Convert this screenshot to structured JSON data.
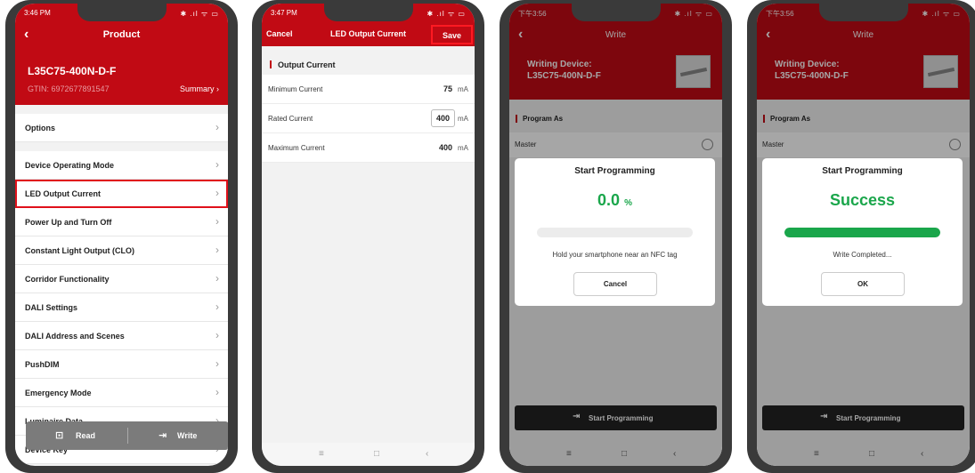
{
  "phone1": {
    "status_time": "3:46 PM",
    "status_icons": "✱ .ıl ᯤ ▭",
    "title": "Product",
    "device_name": "L35C75-400N-D-F",
    "gtin": "GTIN: 6972677891547",
    "summary_link": "Summary",
    "menu_items": [
      "Options",
      "Device Operating Mode",
      "LED Output Current",
      "Power Up and Turn Off",
      "Constant Light Output (CLO)",
      "Corridor Functionality",
      "DALI Settings",
      "DALI Address and Scenes",
      "PushDIM",
      "Emergency Mode",
      "Luminaire Data",
      "Device Key"
    ],
    "read_label": "Read",
    "write_label": "Write"
  },
  "phone2": {
    "status_time": "3:47 PM",
    "status_icons": "✱ .ıl ᯤ ▭",
    "cancel_label": "Cancel",
    "title": "LED Output Current",
    "save_label": "Save",
    "section_title": "Output Current",
    "fields": [
      {
        "label": "Minimum Current",
        "value": "75",
        "unit": "mA"
      },
      {
        "label": "Rated Current",
        "value": "400",
        "unit": "mA"
      },
      {
        "label": "Maximum Current",
        "value": "400",
        "unit": "mA"
      }
    ]
  },
  "phone3": {
    "status_time": "下午3:56",
    "status_icons": "✱ .ıl ᯤ ▭",
    "title": "Write",
    "writing_device_label": "Writing Device:",
    "device_name": "L35C75-400N-D-F",
    "section_title": "Program As",
    "master_label": "Master",
    "dialog_title": "Start Programming",
    "progress_value": "0.0",
    "progress_unit": "%",
    "progress_fraction": 0.0,
    "message": "Hold your smartphone near an NFC tag",
    "button_label": "Cancel",
    "start_label": "Start Programming"
  },
  "phone4": {
    "status_time": "下午3:56",
    "status_icons": "✱ .ıl ᯤ ▭",
    "title": "Write",
    "writing_device_label": "Writing Device:",
    "device_name": "L35C75-400N-D-F",
    "section_title": "Program As",
    "master_label": "Master",
    "dialog_title": "Start Programming",
    "result_text": "Success",
    "progress_fraction": 1.0,
    "message": "Write Completed...",
    "button_label": "OK",
    "start_label": "Start Programming"
  },
  "colors": {
    "brand_red": "#c10a14",
    "success_green": "#1aa64b",
    "highlight_red": "#e0101a"
  },
  "icons": [
    "back-chevron-icon",
    "chevron-right-icon",
    "read-icon",
    "write-icon",
    "nfc-write-icon",
    "radio-icon"
  ]
}
